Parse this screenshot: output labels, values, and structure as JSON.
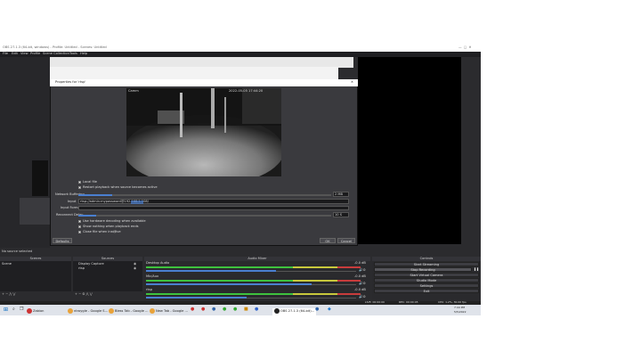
{
  "window": {
    "title": "OBS 27.1.3 (64-bit, windows) - Profile: Untitled - Scenes: Untitled"
  },
  "menu": [
    "File",
    "Edit",
    "View",
    "Profile",
    "Scene Collection",
    "Tools",
    "Help"
  ],
  "dialog": {
    "title": "Properties for 'rtsp'",
    "preview_label": "Camm",
    "timestamp": "2022-05-05 17:44:20",
    "local_file_label": "Local file",
    "restart_label": "Restart playback when source becomes active",
    "network_buffering_label": "Network Buffering",
    "network_buffering_value": "2 MB",
    "input_label": "Input",
    "input_value": "rtsp://admin:mypassword@192.168.1.108/",
    "input_format_label": "Input Format",
    "reconnect_label": "Reconnect Delay",
    "reconnect_value": "10 S",
    "hw_decoding_label": "Use hardware decoding when available",
    "show_nothing_label": "Show nothing when playback ends",
    "close_file_label": "Close file when inactive",
    "defaults_button": "Defaults",
    "ok_button": "OK",
    "cancel_button": "Cancel"
  },
  "status": {
    "no_source": "No source selected"
  },
  "docks": {
    "scenes": "Scenes",
    "sources": "Sources",
    "audio_mixer": "Audio Mixer",
    "controls": "Controls",
    "scene_item": "Scene",
    "source_items": [
      "Display Capture",
      "rtsp"
    ]
  },
  "mixer": {
    "tracks": [
      {
        "name": "Desktop Audio",
        "db": "-0.0 dB",
        "level": 0.62,
        "color": "#3ec23e"
      },
      {
        "name": "Mic/Aux",
        "db": "-0.0 dB",
        "level": 0.79,
        "color": "#3ec23e"
      },
      {
        "name": "rtsp",
        "db": "-0.0 dB",
        "level": 0.48,
        "color": "#3ec23e"
      }
    ]
  },
  "controls": [
    "Start Streaming",
    "Stop Recording",
    "Start Virtual Camera",
    "Studio Mode",
    "Settings",
    "Exit"
  ],
  "statusbar": {
    "live": "LIVE: 00:00:00",
    "rec": "REC: 00:00:45",
    "cpu": "CPU: 1.2%, 30.00 fps"
  },
  "taskbar": {
    "items": [
      "Zabion",
      "ntroygle - Google S...",
      "Bless Tab - Google ...",
      "New Tab - Google ...",
      "OBS 27.1.3 (64-bit)..."
    ],
    "time": "7:44 PM",
    "date": "5/5/2022"
  },
  "colors": {
    "obs_bg": "#2b2b2e",
    "dialog_bg": "#3a3a3e",
    "preview_bg": "#000000",
    "meter_green": "#3ec23e",
    "meter_yellow": "#c8c83c",
    "meter_red": "#c83c3c",
    "selection": "#4a7fd0"
  }
}
